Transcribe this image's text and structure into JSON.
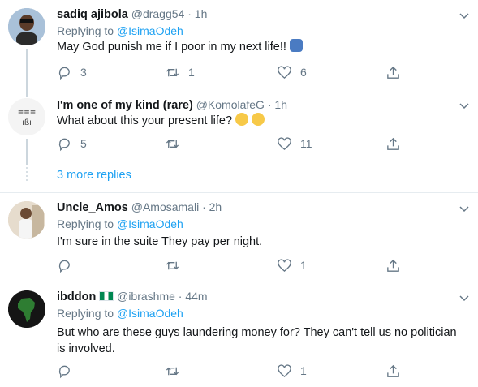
{
  "tweets": [
    {
      "name": "sadiq ajibola",
      "handle": "@dragg54",
      "separator": "·",
      "time": "1h",
      "replying_label": "Replying to",
      "replying_to": "@IsimaOdeh",
      "text": "May God punish me if I poor in my next life!!",
      "emoji": "person-facepalming",
      "replies": "3",
      "retweets": "1",
      "likes": "6"
    },
    {
      "name": "I'm one of my kind (rare)",
      "handle": "@KomolafeG",
      "separator": "·",
      "time": "1h",
      "text": "What about this your present life?",
      "emoji": "face-with-tears-of-joy x2",
      "replies": "5",
      "retweets": "",
      "likes": "11"
    },
    {
      "name": "Uncle_Amos",
      "handle": "@Amosamali",
      "separator": "·",
      "time": "2h",
      "replying_label": "Replying to",
      "replying_to": "@IsimaOdeh",
      "text": "I'm sure in the suite They pay per night.",
      "replies": "",
      "retweets": "",
      "likes": "1"
    },
    {
      "name": "ibddon",
      "flag": "nigeria-flag",
      "handle": "@ibrashme",
      "separator": "·",
      "time": "44m",
      "replying_label": "Replying to",
      "replying_to": "@IsimaOdeh",
      "text": "But who are these guys laundering money for? They can't tell us no politician is involved.",
      "replies": "",
      "retweets": "",
      "likes": "1"
    }
  ],
  "more_replies": "3 more replies",
  "colors": {
    "link": "#1da1f2",
    "muted": "#657786",
    "divider": "#e6ecf0",
    "thread_line": "#ccd6dd"
  }
}
